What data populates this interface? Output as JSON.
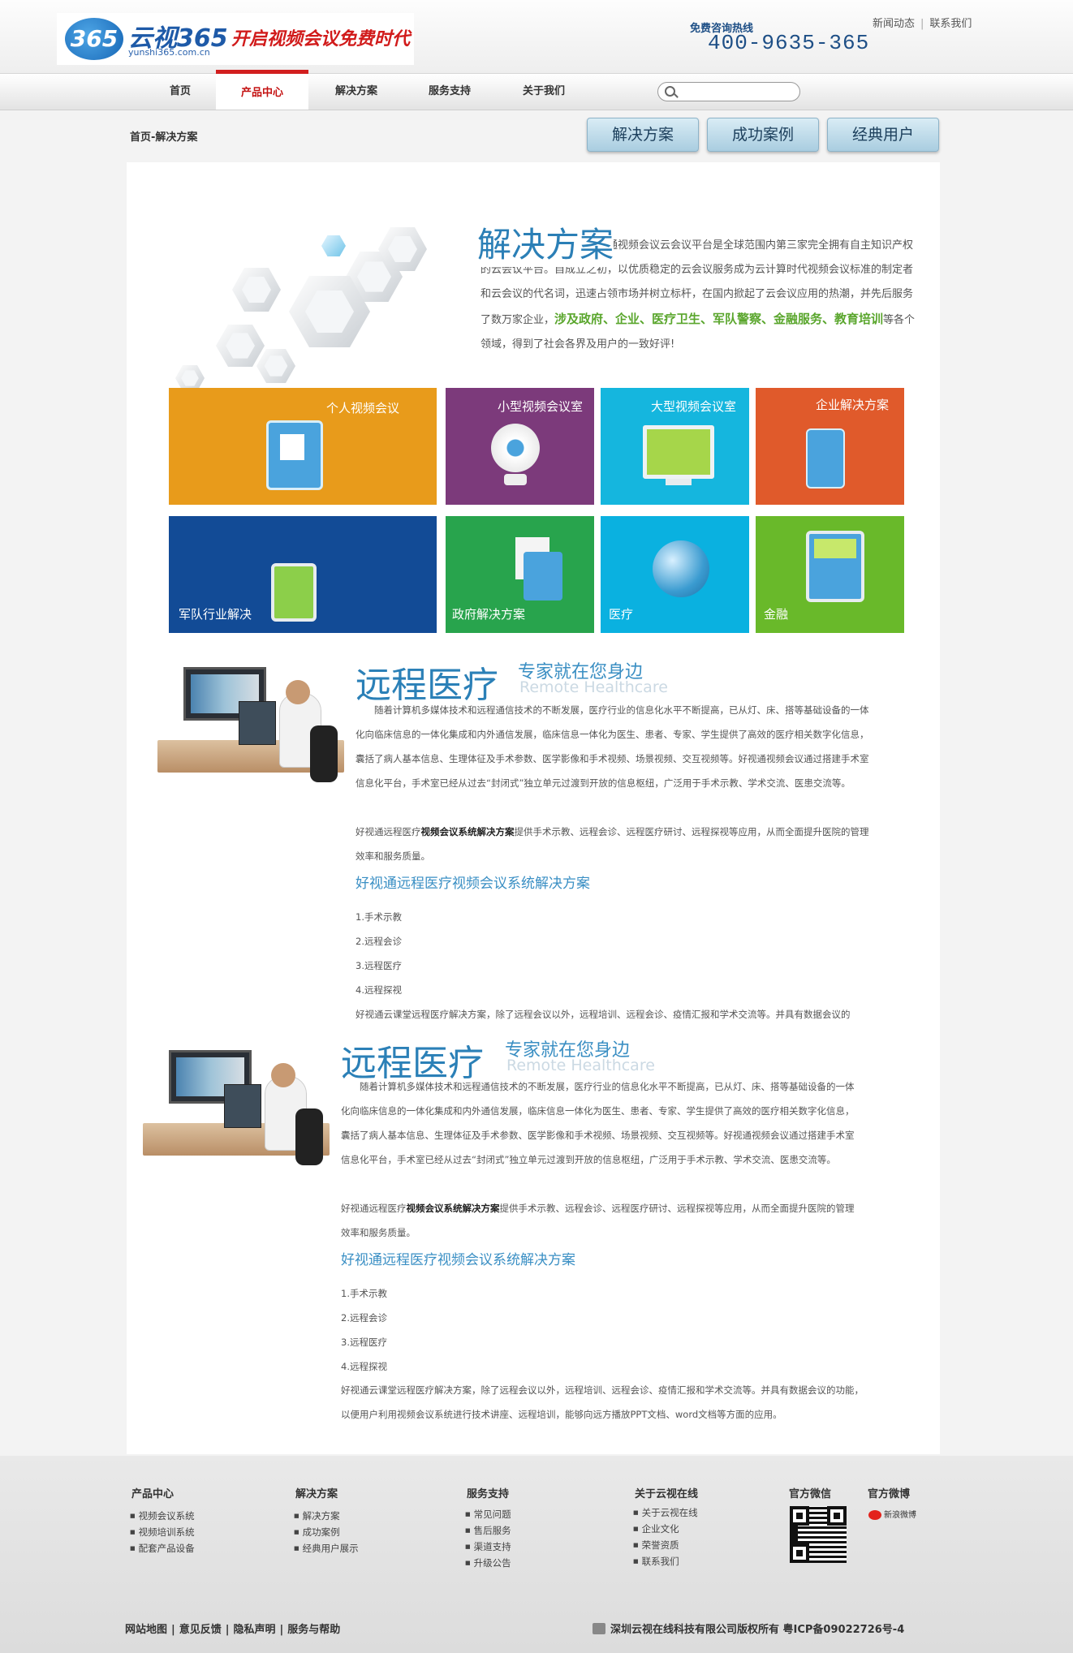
{
  "header": {
    "logo_mark": "365",
    "logo_name": "云视365",
    "logo_domain": "yunshi365.com.cn",
    "logo_slogan": "开启视频会议免费时代",
    "hotline_label": "免费咨询热线",
    "hotline_number": "400-9635-365",
    "top_links": [
      "新闻动态",
      "联系我们"
    ]
  },
  "nav": {
    "items": [
      "首页",
      "产品中心",
      "解决方案",
      "服务支持",
      "关于我们"
    ],
    "active": "产品中心",
    "search_placeholder": ""
  },
  "breadcrumb": "首页-解决方案",
  "section_buttons": [
    "解决方案",
    "成功案例",
    "经典用户"
  ],
  "intro": {
    "title": "解决方案",
    "text_a": "好视通视频会议云会议平台是全球范围内第三家完全拥有自主知识产权的云会议平台。自成立之初，以优质稳定的云会议服务成为云计算时代视频会议标准的制定者和云会议的代名词，迅速占领市场并树立标杆，在国内掀起了云会议应用的热潮，并先后服务了数万家企业，",
    "text_highlight": "涉及政府、企业、医疗卫生、军队警察、金融服务、教育培训",
    "text_b": "等各个领域，得到了社会各界及用户的一致好评!"
  },
  "tiles": [
    {
      "label": "个人视频会议",
      "color": "#e89b1b",
      "icon": "id-badge-icon"
    },
    {
      "label": "小型视频会议室",
      "color": "#7c3a7b",
      "icon": "webcam-icon"
    },
    {
      "label": "大型视频会议室",
      "color": "#15b6de",
      "icon": "monitor-icon"
    },
    {
      "label": "企业解决方案",
      "color": "#e05a2b",
      "icon": "phone-icon"
    },
    {
      "label": "军队行业解决",
      "color": "#124b96",
      "icon": "tablet-pen-icon"
    },
    {
      "label": "政府解决方案",
      "color": "#28a44d",
      "icon": "document-icon"
    },
    {
      "label": "医疗",
      "color": "#0ab1e0",
      "icon": "globe-leaf-icon"
    },
    {
      "label": "金融",
      "color": "#69b92a",
      "icon": "calculator-icon"
    }
  ],
  "article": {
    "title": "远程医疗",
    "subtitle": "专家就在您身边",
    "subtitle_en": "Remote Healthcare",
    "para1": "随着计算机多媒体技术和远程通信技术的不断发展，医疗行业的信息化水平不断提高，已从灯、床、搭等基础设备的一体化向临床信息的一体化集成和内外通信发展，临床信息一体化为医生、患者、专家、学生提供了高效的医疗相关数字化信息，囊括了病人基本信息、生理体征及手术参数、医学影像和手术视频、场景视频、交互视频等。好视通视频会议通过搭建手术室信息化平台，手术室已经从过去“封闭式”独立单元过渡到开放的信息枢纽，广泛用于手术示教、学术交流、医患交流等。",
    "para2_a": "好视通远程医疗",
    "para2_bold": "视频会议系统解决方案",
    "para2_b": "提供手术示教、远程会诊、远程医疗研讨、远程探视等应用，从而全面提升医院的管理效率和服务质量。",
    "heading": "好视通远程医疗视频会议系统解决方案",
    "list": [
      "1.手术示教",
      "2.远程会诊",
      "3.远程医疗",
      "4.远程探视"
    ],
    "para3_first": "好视通云课堂远程医疗解决方案，除了远程会议以外，远程培训、远程会诊、疫情汇报和学术交流等。并具有数据会议的",
    "para3_full": "好视通云课堂远程医疗解决方案，除了远程会议以外，远程培训、远程会诊、疫情汇报和学术交流等。并具有数据会议的功能，以便用户利用视频会议系统进行技术讲座、远程培训，能够向远方播放PPT文档、word文档等方面的应用。"
  },
  "footer": {
    "columns": [
      {
        "title": "产品中心",
        "links": [
          "视频会议系统",
          "视频培训系统",
          "配套产品设备"
        ]
      },
      {
        "title": "解决方案",
        "links": [
          "解决方案",
          "成功案例",
          "经典用户展示"
        ]
      },
      {
        "title": "服务支持",
        "links": [
          "常见问题",
          "售后服务",
          "渠道支持",
          "升级公告"
        ]
      },
      {
        "title": "关于云视在线",
        "links": [
          "关于云视在线",
          "企业文化",
          "荣誉资质",
          "联系我们"
        ]
      }
    ],
    "wechat_title": "官方微信",
    "weibo_title": "官方微博",
    "weibo_text": "新浪微博",
    "bottom_links": [
      "网站地图",
      "意见反馈",
      "隐私声明",
      "服务与帮助"
    ],
    "copyright": "深圳云视在线科技有限公司版权所有 粤ICP备09022726号-4"
  }
}
